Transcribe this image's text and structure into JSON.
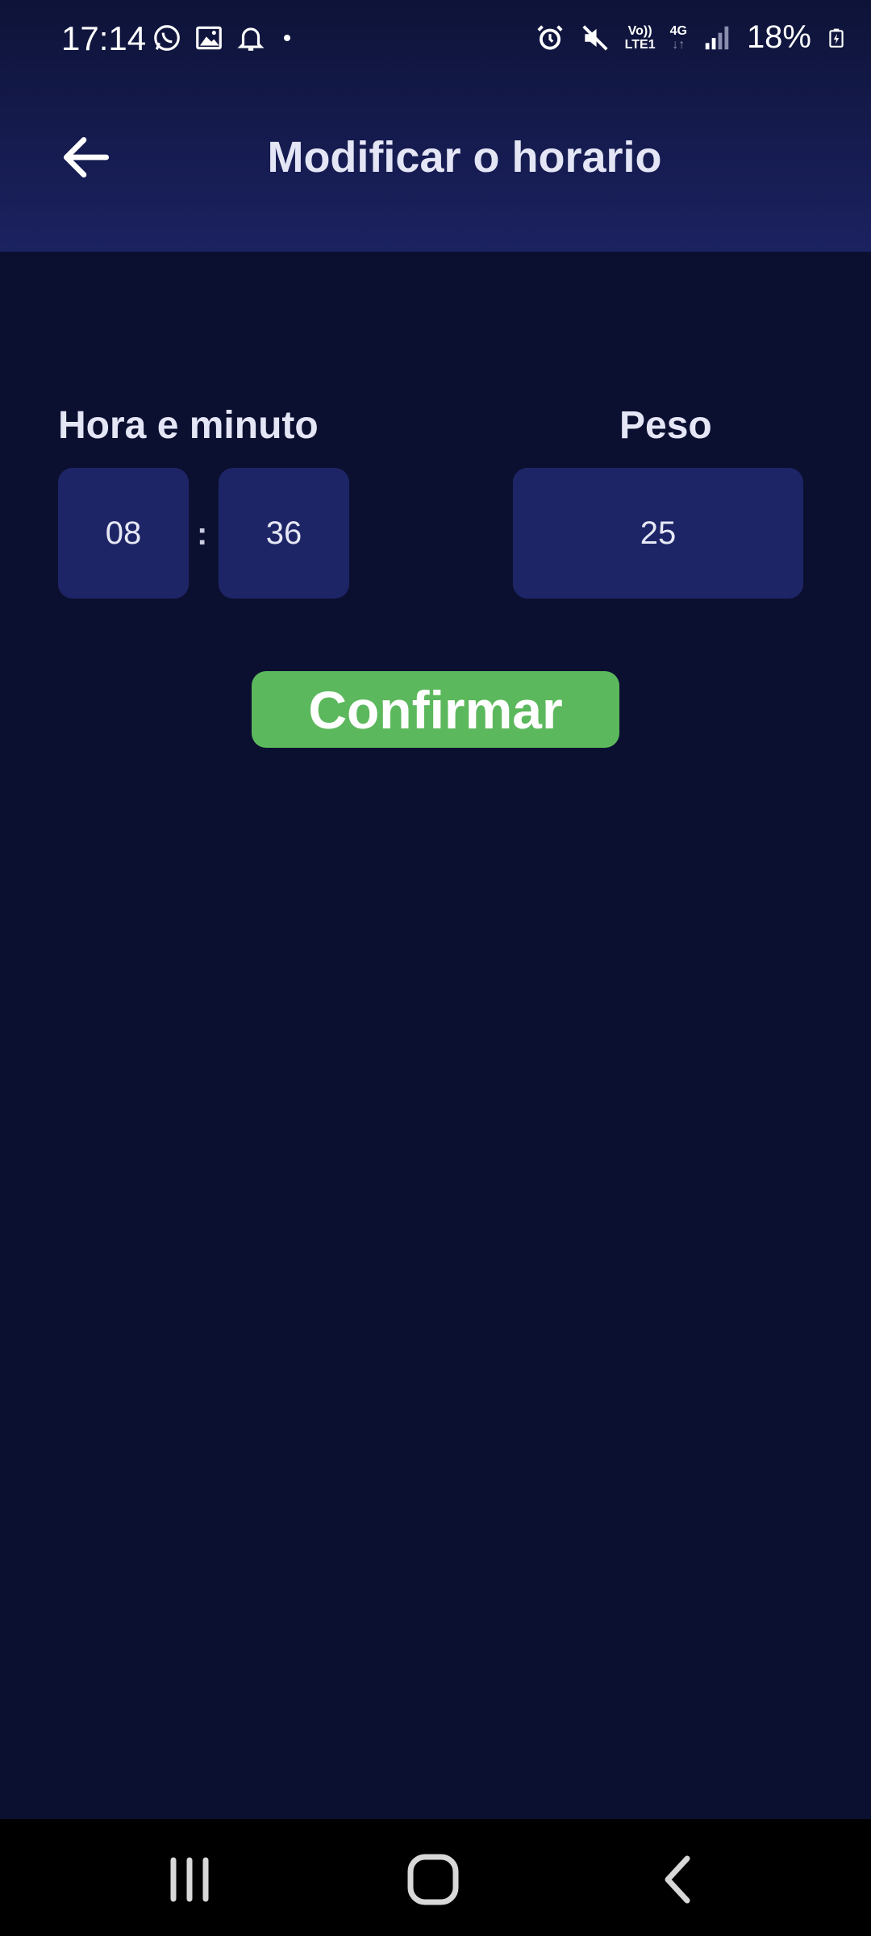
{
  "status_bar": {
    "time": "17:14",
    "left_icons": [
      "whatsapp-icon",
      "image-icon",
      "bell-icon",
      "dot-icon"
    ],
    "right_icons": [
      "alarm-icon",
      "mute-icon",
      "volte-icon",
      "4g-icon",
      "signal-icon",
      "battery-charging-icon"
    ],
    "volte_top": "Vo))",
    "volte_bottom": "LTE1",
    "network": "4G",
    "battery_percent": "18%"
  },
  "app_bar": {
    "title": "Modificar o horario",
    "back_icon": "arrow-left-icon"
  },
  "form": {
    "time_label": "Hora e minuto",
    "hour": "08",
    "separator": ":",
    "minute": "36",
    "weight_label": "Peso",
    "weight": "25"
  },
  "actions": {
    "confirm_label": "Confirmar",
    "confirm_color": "#5cb85c"
  },
  "nav_bar": {
    "buttons": [
      "recent-apps-icon",
      "home-icon",
      "back-icon"
    ]
  },
  "colors": {
    "background": "#0c1030",
    "field": "#1e2567",
    "header_top": "#0e1338",
    "header_bottom": "#1b2260"
  }
}
